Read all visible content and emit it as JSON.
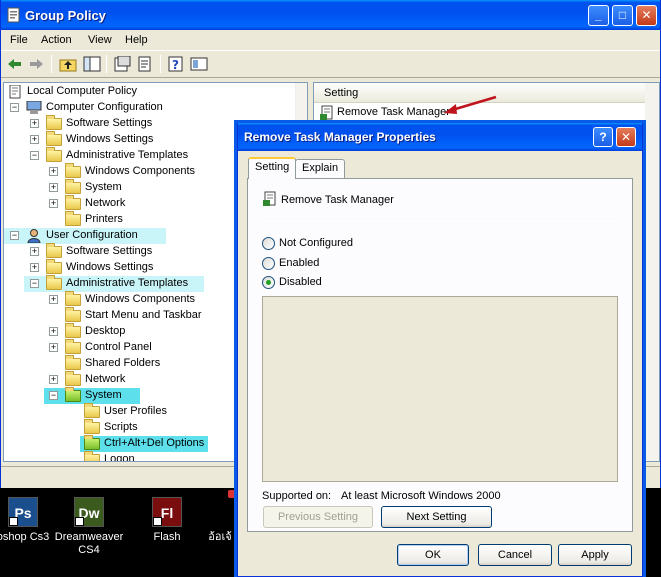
{
  "window": {
    "title": "Group Policy",
    "buttons": {
      "minimize": "_",
      "maximize": "□",
      "close": "✕"
    }
  },
  "menu": [
    "File",
    "Action",
    "View",
    "Help"
  ],
  "toolbar_icons": [
    "back-arrow-icon",
    "forward-arrow-icon",
    "up-folder-icon",
    "show-hide-tree-icon",
    "properties-icon",
    "export-list-icon",
    "help-icon",
    "view-icon"
  ],
  "tree": {
    "root": "Local Computer Policy",
    "computer_configuration": "Computer Configuration",
    "computer_items": {
      "software_settings": "Software Settings",
      "windows_settings": "Windows Settings",
      "administrative_templates": "Administrative Templates",
      "windows_components": "Windows Components",
      "system": "System",
      "network": "Network",
      "printers": "Printers"
    },
    "user_configuration": "User Configuration",
    "user_items": {
      "software_settings": "Software Settings",
      "windows_settings": "Windows Settings",
      "administrative_templates": "Administrative Templates",
      "windows_components": "Windows Components",
      "start_menu": "Start Menu and Taskbar",
      "desktop": "Desktop",
      "control_panel": "Control Panel",
      "shared_folders": "Shared Folders",
      "network": "Network",
      "system": "System",
      "user_profiles": "User Profiles",
      "scripts": "Scripts",
      "ctrl_alt_del": "Ctrl+Alt+Del Options",
      "logon": "Logon"
    },
    "expander_plus": "+",
    "expander_minus": "−"
  },
  "list": {
    "column_header": "Setting",
    "item": "Remove Task Manager"
  },
  "desktop_icons": [
    {
      "abbr": "Ps",
      "label": "oshop Cs3",
      "color": "#1a4e8c"
    },
    {
      "abbr": "Dw",
      "label": "Dreamweaver CS4",
      "label2": "CS4",
      "label1": "Dreamweaver",
      "color": "#3b5b1e"
    },
    {
      "abbr": "Fl",
      "label": "Flash",
      "color": "#7a0d0d"
    },
    {
      "abbr": "",
      "label": "อ้อเจ้",
      "color": "#000"
    }
  ],
  "dialog": {
    "title": "Remove Task Manager Properties",
    "help_button": "?",
    "close_button": "✕",
    "tabs": {
      "setting": "Setting",
      "explain": "Explain"
    },
    "policy_name": "Remove Task Manager",
    "options": {
      "not_configured": "Not Configured",
      "enabled": "Enabled",
      "disabled": "Disabled"
    },
    "selected_option": "disabled",
    "supported_on_label": "Supported on:",
    "supported_on_value": "At least Microsoft Windows 2000",
    "previous_setting": "Previous Setting",
    "next_setting": "Next Setting",
    "ok": "OK",
    "cancel": "Cancel",
    "apply": "Apply"
  },
  "colors": {
    "xp_blue": "#0053ee",
    "highlight": "#c9f4f8",
    "arrow_red": "#c0141c"
  }
}
